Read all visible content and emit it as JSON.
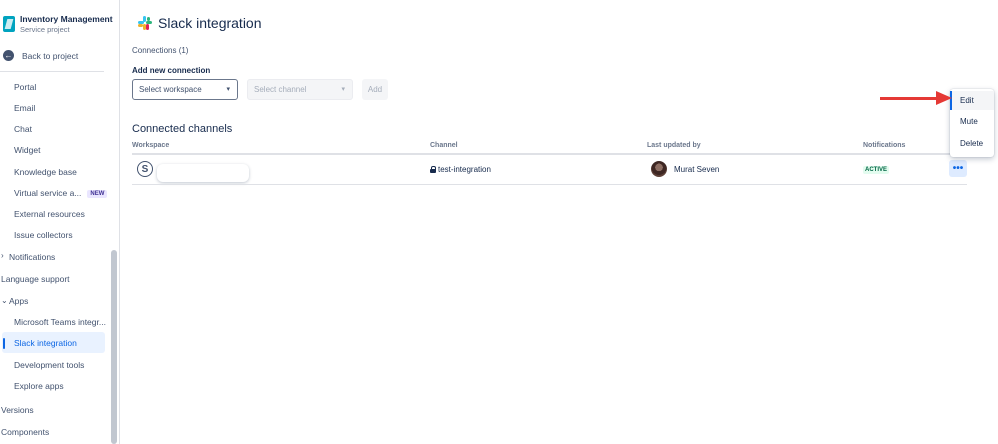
{
  "project": {
    "name": "Inventory Management",
    "type": "Service project"
  },
  "sidebar": {
    "back_label": "Back to project",
    "items": [
      {
        "label": "Portal"
      },
      {
        "label": "Email"
      },
      {
        "label": "Chat"
      },
      {
        "label": "Widget"
      },
      {
        "label": "Knowledge base"
      },
      {
        "label": "Virtual service a...",
        "badge": "NEW"
      },
      {
        "label": "External resources"
      },
      {
        "label": "Issue collectors"
      },
      {
        "label": "Notifications"
      },
      {
        "label": "Language support"
      },
      {
        "label": "Apps"
      },
      {
        "label": "Microsoft Teams integr..."
      },
      {
        "label": "Slack integration"
      },
      {
        "label": "Development tools"
      },
      {
        "label": "Explore apps"
      },
      {
        "label": "Versions"
      },
      {
        "label": "Components"
      }
    ]
  },
  "page": {
    "title": "Slack integration",
    "connections_count": "Connections (1)",
    "add_new_label": "Add new connection",
    "workspace_placeholder": "Select workspace",
    "channel_placeholder": "Select channel",
    "add_button": "Add",
    "connected_heading": "Connected channels"
  },
  "table": {
    "headers": [
      "Workspace",
      "Channel",
      "Last updated by",
      "Notifications"
    ],
    "rows": [
      {
        "channel": "test-integration",
        "updated_by": "Murat Seven",
        "status": "ACTIVE",
        "more": "•••"
      }
    ]
  },
  "menu": {
    "items": [
      "Edit",
      "Mute",
      "Delete"
    ]
  },
  "colors": {
    "accent": "#0c66e4",
    "annotation_arrow": "#e53935",
    "active_status": "#006644"
  }
}
